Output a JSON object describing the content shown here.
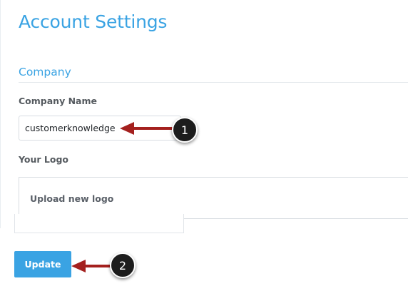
{
  "page": {
    "title": "Account Settings"
  },
  "company_section": {
    "heading": "Company",
    "company_name_label": "Company Name",
    "company_name_value": "customerknowledge",
    "logo_label": "Your Logo",
    "upload_logo_label": "Upload new logo"
  },
  "actions": {
    "update_label": "Update"
  },
  "annotations": {
    "callout_1": "1",
    "callout_2": "2",
    "arrow_color": "#a4201e"
  },
  "colors": {
    "accent": "#3aa3e3"
  }
}
